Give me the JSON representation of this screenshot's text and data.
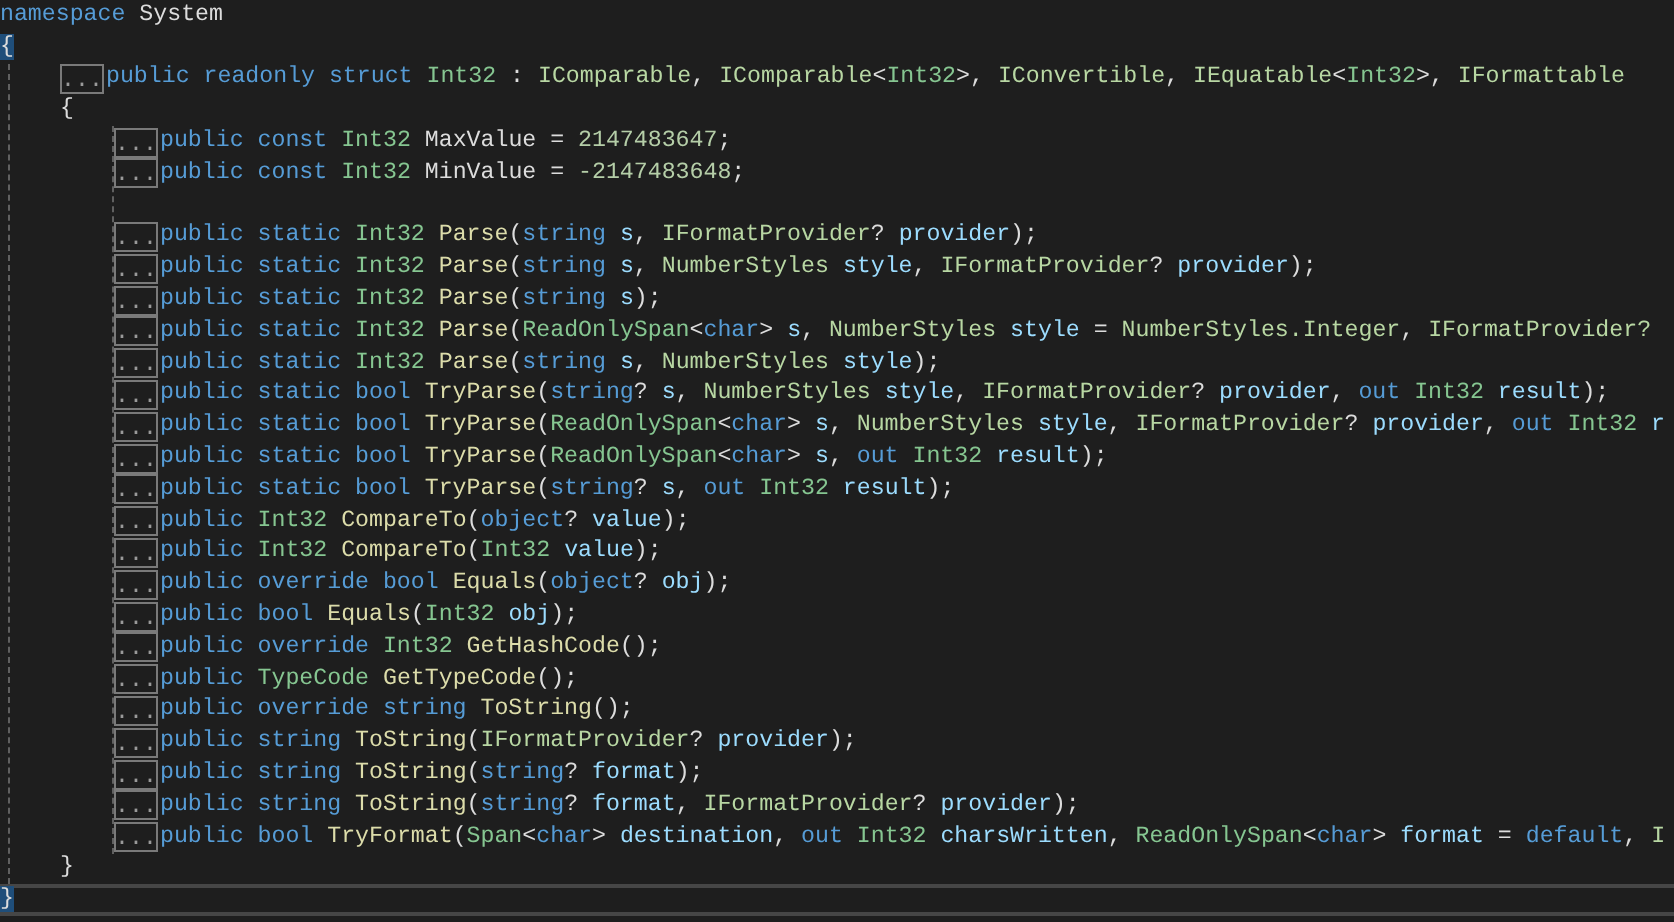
{
  "editor": {
    "lines": [
      {
        "kind": "code",
        "current": false,
        "tokens": [
          {
            "text": "namespace",
            "kind": "keyword"
          },
          {
            "text": " System",
            "kind": "plain"
          }
        ]
      },
      {
        "kind": "code",
        "current": false,
        "tokens": [
          {
            "text": "{",
            "kind": "brace",
            "matched": true
          }
        ],
        "children": [
          {
            "kind": "code",
            "current": false,
            "fold": "...",
            "tokens": [
              {
                "text": "public readonly struct ",
                "kind": "keyword"
              },
              {
                "text": "Int32",
                "kind": "type"
              },
              {
                "text": " : ",
                "kind": "plain"
              },
              {
                "text": "IComparable",
                "kind": "interface"
              },
              {
                "text": ", ",
                "kind": "plain"
              },
              {
                "text": "IComparable",
                "kind": "interface"
              },
              {
                "text": "<",
                "kind": "plain"
              },
              {
                "text": "Int32",
                "kind": "type"
              },
              {
                "text": ">, ",
                "kind": "plain"
              },
              {
                "text": "IConvertible",
                "kind": "interface"
              },
              {
                "text": ", ",
                "kind": "plain"
              },
              {
                "text": "IEquatable",
                "kind": "interface"
              },
              {
                "text": "<",
                "kind": "plain"
              },
              {
                "text": "Int32",
                "kind": "type"
              },
              {
                "text": ">, ",
                "kind": "plain"
              },
              {
                "text": "IFormattable",
                "kind": "interface"
              }
            ]
          },
          {
            "kind": "code",
            "current": false,
            "tokens": [
              {
                "text": "{",
                "kind": "brace",
                "matched": false
              }
            ],
            "children": [
              {
                "kind": "code",
                "current": false,
                "fold": "...",
                "tokens": [
                  {
                    "text": "public const ",
                    "kind": "keyword"
                  },
                  {
                    "text": "Int32",
                    "kind": "type"
                  },
                  {
                    "text": " MaxValue = ",
                    "kind": "plain"
                  },
                  {
                    "text": "2147483647",
                    "kind": "number"
                  },
                  {
                    "text": ";",
                    "kind": "plain"
                  }
                ]
              },
              {
                "kind": "code",
                "current": false,
                "fold": "...",
                "tokens": [
                  {
                    "text": "public const ",
                    "kind": "keyword"
                  },
                  {
                    "text": "Int32",
                    "kind": "type"
                  },
                  {
                    "text": " MinValue = ",
                    "kind": "plain"
                  },
                  {
                    "text": "-2147483648",
                    "kind": "number"
                  },
                  {
                    "text": ";",
                    "kind": "plain"
                  }
                ]
              },
              {
                "kind": "blank",
                "current": false
              },
              {
                "kind": "code",
                "current": false,
                "fold": "...",
                "tokens": [
                  {
                    "text": "public static ",
                    "kind": "keyword"
                  },
                  {
                    "text": "Int32 ",
                    "kind": "type"
                  },
                  {
                    "text": "Parse",
                    "kind": "method"
                  },
                  {
                    "text": "(",
                    "kind": "plain"
                  },
                  {
                    "text": "string ",
                    "kind": "keyword"
                  },
                  {
                    "text": "s",
                    "kind": "param"
                  },
                  {
                    "text": ", ",
                    "kind": "plain"
                  },
                  {
                    "text": "IFormatProvider",
                    "kind": "interface"
                  },
                  {
                    "text": "? ",
                    "kind": "plain"
                  },
                  {
                    "text": "provider",
                    "kind": "param"
                  },
                  {
                    "text": ");",
                    "kind": "plain"
                  }
                ]
              },
              {
                "kind": "code",
                "current": false,
                "fold": "...",
                "tokens": [
                  {
                    "text": "public static ",
                    "kind": "keyword"
                  },
                  {
                    "text": "Int32 ",
                    "kind": "type"
                  },
                  {
                    "text": "Parse",
                    "kind": "method"
                  },
                  {
                    "text": "(",
                    "kind": "plain"
                  },
                  {
                    "text": "string ",
                    "kind": "keyword"
                  },
                  {
                    "text": "s",
                    "kind": "param"
                  },
                  {
                    "text": ", ",
                    "kind": "plain"
                  },
                  {
                    "text": "NumberStyles ",
                    "kind": "interface"
                  },
                  {
                    "text": "style",
                    "kind": "param"
                  },
                  {
                    "text": ", ",
                    "kind": "plain"
                  },
                  {
                    "text": "IFormatProvider",
                    "kind": "interface"
                  },
                  {
                    "text": "? ",
                    "kind": "plain"
                  },
                  {
                    "text": "provider",
                    "kind": "param"
                  },
                  {
                    "text": ");",
                    "kind": "plain"
                  }
                ]
              },
              {
                "kind": "code",
                "current": false,
                "fold": "...",
                "tokens": [
                  {
                    "text": "public static ",
                    "kind": "keyword"
                  },
                  {
                    "text": "Int32 ",
                    "kind": "type"
                  },
                  {
                    "text": "Parse",
                    "kind": "method"
                  },
                  {
                    "text": "(",
                    "kind": "plain"
                  },
                  {
                    "text": "string ",
                    "kind": "keyword"
                  },
                  {
                    "text": "s",
                    "kind": "param"
                  },
                  {
                    "text": ");",
                    "kind": "plain"
                  }
                ]
              },
              {
                "kind": "code",
                "current": false,
                "fold": "...",
                "tokens": [
                  {
                    "text": "public static ",
                    "kind": "keyword"
                  },
                  {
                    "text": "Int32 ",
                    "kind": "type"
                  },
                  {
                    "text": "Parse",
                    "kind": "method"
                  },
                  {
                    "text": "(",
                    "kind": "plain"
                  },
                  {
                    "text": "ReadOnlySpan",
                    "kind": "type"
                  },
                  {
                    "text": "<",
                    "kind": "plain"
                  },
                  {
                    "text": "char",
                    "kind": "keyword"
                  },
                  {
                    "text": "> ",
                    "kind": "plain"
                  },
                  {
                    "text": "s",
                    "kind": "param"
                  },
                  {
                    "text": ", ",
                    "kind": "plain"
                  },
                  {
                    "text": "NumberStyles ",
                    "kind": "interface"
                  },
                  {
                    "text": "style",
                    "kind": "param"
                  },
                  {
                    "text": " = ",
                    "kind": "plain"
                  },
                  {
                    "text": "NumberStyles.Integer",
                    "kind": "interface"
                  },
                  {
                    "text": ", ",
                    "kind": "plain"
                  },
                  {
                    "text": "IFormatProvider?",
                    "kind": "interface"
                  }
                ]
              },
              {
                "kind": "code",
                "current": false,
                "fold": "...",
                "tokens": [
                  {
                    "text": "public static ",
                    "kind": "keyword"
                  },
                  {
                    "text": "Int32 ",
                    "kind": "type"
                  },
                  {
                    "text": "Parse",
                    "kind": "method"
                  },
                  {
                    "text": "(",
                    "kind": "plain"
                  },
                  {
                    "text": "string ",
                    "kind": "keyword"
                  },
                  {
                    "text": "s",
                    "kind": "param"
                  },
                  {
                    "text": ", ",
                    "kind": "plain"
                  },
                  {
                    "text": "NumberStyles ",
                    "kind": "interface"
                  },
                  {
                    "text": "style",
                    "kind": "param"
                  },
                  {
                    "text": ");",
                    "kind": "plain"
                  }
                ]
              },
              {
                "kind": "code",
                "current": false,
                "fold": "...",
                "tokens": [
                  {
                    "text": "public static bool ",
                    "kind": "keyword"
                  },
                  {
                    "text": "TryParse",
                    "kind": "method"
                  },
                  {
                    "text": "(",
                    "kind": "plain"
                  },
                  {
                    "text": "string",
                    "kind": "keyword"
                  },
                  {
                    "text": "? ",
                    "kind": "plain"
                  },
                  {
                    "text": "s",
                    "kind": "param"
                  },
                  {
                    "text": ", ",
                    "kind": "plain"
                  },
                  {
                    "text": "NumberStyles ",
                    "kind": "interface"
                  },
                  {
                    "text": "style",
                    "kind": "param"
                  },
                  {
                    "text": ", ",
                    "kind": "plain"
                  },
                  {
                    "text": "IFormatProvider",
                    "kind": "interface"
                  },
                  {
                    "text": "? ",
                    "kind": "plain"
                  },
                  {
                    "text": "provider",
                    "kind": "param"
                  },
                  {
                    "text": ", ",
                    "kind": "plain"
                  },
                  {
                    "text": "out ",
                    "kind": "keyword"
                  },
                  {
                    "text": "Int32 ",
                    "kind": "type"
                  },
                  {
                    "text": "result",
                    "kind": "param"
                  },
                  {
                    "text": ");",
                    "kind": "plain"
                  }
                ]
              },
              {
                "kind": "code",
                "current": false,
                "fold": "...",
                "tokens": [
                  {
                    "text": "public static bool ",
                    "kind": "keyword"
                  },
                  {
                    "text": "TryParse",
                    "kind": "method"
                  },
                  {
                    "text": "(",
                    "kind": "plain"
                  },
                  {
                    "text": "ReadOnlySpan",
                    "kind": "type"
                  },
                  {
                    "text": "<",
                    "kind": "plain"
                  },
                  {
                    "text": "char",
                    "kind": "keyword"
                  },
                  {
                    "text": "> ",
                    "kind": "plain"
                  },
                  {
                    "text": "s",
                    "kind": "param"
                  },
                  {
                    "text": ", ",
                    "kind": "plain"
                  },
                  {
                    "text": "NumberStyles ",
                    "kind": "interface"
                  },
                  {
                    "text": "style",
                    "kind": "param"
                  },
                  {
                    "text": ", ",
                    "kind": "plain"
                  },
                  {
                    "text": "IFormatProvider",
                    "kind": "interface"
                  },
                  {
                    "text": "? ",
                    "kind": "plain"
                  },
                  {
                    "text": "provider",
                    "kind": "param"
                  },
                  {
                    "text": ", ",
                    "kind": "plain"
                  },
                  {
                    "text": "out ",
                    "kind": "keyword"
                  },
                  {
                    "text": "Int32 ",
                    "kind": "type"
                  },
                  {
                    "text": "r",
                    "kind": "param"
                  }
                ]
              },
              {
                "kind": "code",
                "current": false,
                "fold": "...",
                "tokens": [
                  {
                    "text": "public static bool ",
                    "kind": "keyword"
                  },
                  {
                    "text": "TryParse",
                    "kind": "method"
                  },
                  {
                    "text": "(",
                    "kind": "plain"
                  },
                  {
                    "text": "ReadOnlySpan",
                    "kind": "type"
                  },
                  {
                    "text": "<",
                    "kind": "plain"
                  },
                  {
                    "text": "char",
                    "kind": "keyword"
                  },
                  {
                    "text": "> ",
                    "kind": "plain"
                  },
                  {
                    "text": "s",
                    "kind": "param"
                  },
                  {
                    "text": ", ",
                    "kind": "plain"
                  },
                  {
                    "text": "out ",
                    "kind": "keyword"
                  },
                  {
                    "text": "Int32 ",
                    "kind": "type"
                  },
                  {
                    "text": "result",
                    "kind": "param"
                  },
                  {
                    "text": ");",
                    "kind": "plain"
                  }
                ]
              },
              {
                "kind": "code",
                "current": false,
                "fold": "...",
                "tokens": [
                  {
                    "text": "public static bool ",
                    "kind": "keyword"
                  },
                  {
                    "text": "TryParse",
                    "kind": "method"
                  },
                  {
                    "text": "(",
                    "kind": "plain"
                  },
                  {
                    "text": "string",
                    "kind": "keyword"
                  },
                  {
                    "text": "? ",
                    "kind": "plain"
                  },
                  {
                    "text": "s",
                    "kind": "param"
                  },
                  {
                    "text": ", ",
                    "kind": "plain"
                  },
                  {
                    "text": "out ",
                    "kind": "keyword"
                  },
                  {
                    "text": "Int32 ",
                    "kind": "type"
                  },
                  {
                    "text": "result",
                    "kind": "param"
                  },
                  {
                    "text": ");",
                    "kind": "plain"
                  }
                ]
              },
              {
                "kind": "code",
                "current": false,
                "fold": "...",
                "tokens": [
                  {
                    "text": "public ",
                    "kind": "keyword"
                  },
                  {
                    "text": "Int32 ",
                    "kind": "type"
                  },
                  {
                    "text": "CompareTo",
                    "kind": "method"
                  },
                  {
                    "text": "(",
                    "kind": "plain"
                  },
                  {
                    "text": "object",
                    "kind": "keyword"
                  },
                  {
                    "text": "? ",
                    "kind": "plain"
                  },
                  {
                    "text": "value",
                    "kind": "param"
                  },
                  {
                    "text": ");",
                    "kind": "plain"
                  }
                ]
              },
              {
                "kind": "code",
                "current": false,
                "fold": "...",
                "tokens": [
                  {
                    "text": "public ",
                    "kind": "keyword"
                  },
                  {
                    "text": "Int32 ",
                    "kind": "type"
                  },
                  {
                    "text": "CompareTo",
                    "kind": "method"
                  },
                  {
                    "text": "(",
                    "kind": "plain"
                  },
                  {
                    "text": "Int32 ",
                    "kind": "type"
                  },
                  {
                    "text": "value",
                    "kind": "param"
                  },
                  {
                    "text": ");",
                    "kind": "plain"
                  }
                ]
              },
              {
                "kind": "code",
                "current": false,
                "fold": "...",
                "tokens": [
                  {
                    "text": "public override bool ",
                    "kind": "keyword"
                  },
                  {
                    "text": "Equals",
                    "kind": "method"
                  },
                  {
                    "text": "(",
                    "kind": "plain"
                  },
                  {
                    "text": "object",
                    "kind": "keyword"
                  },
                  {
                    "text": "? ",
                    "kind": "plain"
                  },
                  {
                    "text": "obj",
                    "kind": "param"
                  },
                  {
                    "text": ");",
                    "kind": "plain"
                  }
                ]
              },
              {
                "kind": "code",
                "current": false,
                "fold": "...",
                "tokens": [
                  {
                    "text": "public bool ",
                    "kind": "keyword"
                  },
                  {
                    "text": "Equals",
                    "kind": "method"
                  },
                  {
                    "text": "(",
                    "kind": "plain"
                  },
                  {
                    "text": "Int32 ",
                    "kind": "type"
                  },
                  {
                    "text": "obj",
                    "kind": "param"
                  },
                  {
                    "text": ");",
                    "kind": "plain"
                  }
                ]
              },
              {
                "kind": "code",
                "current": false,
                "fold": "...",
                "tokens": [
                  {
                    "text": "public override ",
                    "kind": "keyword"
                  },
                  {
                    "text": "Int32 ",
                    "kind": "type"
                  },
                  {
                    "text": "GetHashCode",
                    "kind": "method"
                  },
                  {
                    "text": "();",
                    "kind": "plain"
                  }
                ]
              },
              {
                "kind": "code",
                "current": false,
                "fold": "...",
                "tokens": [
                  {
                    "text": "public ",
                    "kind": "keyword"
                  },
                  {
                    "text": "TypeCode ",
                    "kind": "type"
                  },
                  {
                    "text": "GetTypeCode",
                    "kind": "method"
                  },
                  {
                    "text": "();",
                    "kind": "plain"
                  }
                ]
              },
              {
                "kind": "code",
                "current": false,
                "fold": "...",
                "tokens": [
                  {
                    "text": "public override string ",
                    "kind": "keyword"
                  },
                  {
                    "text": "ToString",
                    "kind": "method"
                  },
                  {
                    "text": "();",
                    "kind": "plain"
                  }
                ]
              },
              {
                "kind": "code",
                "current": false,
                "fold": "...",
                "tokens": [
                  {
                    "text": "public string ",
                    "kind": "keyword"
                  },
                  {
                    "text": "ToString",
                    "kind": "method"
                  },
                  {
                    "text": "(",
                    "kind": "plain"
                  },
                  {
                    "text": "IFormatProvider",
                    "kind": "interface"
                  },
                  {
                    "text": "? ",
                    "kind": "plain"
                  },
                  {
                    "text": "provider",
                    "kind": "param"
                  },
                  {
                    "text": ");",
                    "kind": "plain"
                  }
                ]
              },
              {
                "kind": "code",
                "current": false,
                "fold": "...",
                "tokens": [
                  {
                    "text": "public string ",
                    "kind": "keyword"
                  },
                  {
                    "text": "ToString",
                    "kind": "method"
                  },
                  {
                    "text": "(",
                    "kind": "plain"
                  },
                  {
                    "text": "string",
                    "kind": "keyword"
                  },
                  {
                    "text": "? ",
                    "kind": "plain"
                  },
                  {
                    "text": "format",
                    "kind": "param"
                  },
                  {
                    "text": ");",
                    "kind": "plain"
                  }
                ]
              },
              {
                "kind": "code",
                "current": false,
                "fold": "...",
                "tokens": [
                  {
                    "text": "public string ",
                    "kind": "keyword"
                  },
                  {
                    "text": "ToString",
                    "kind": "method"
                  },
                  {
                    "text": "(",
                    "kind": "plain"
                  },
                  {
                    "text": "string",
                    "kind": "keyword"
                  },
                  {
                    "text": "? ",
                    "kind": "plain"
                  },
                  {
                    "text": "format",
                    "kind": "param"
                  },
                  {
                    "text": ", ",
                    "kind": "plain"
                  },
                  {
                    "text": "IFormatProvider",
                    "kind": "interface"
                  },
                  {
                    "text": "? ",
                    "kind": "plain"
                  },
                  {
                    "text": "provider",
                    "kind": "param"
                  },
                  {
                    "text": ");",
                    "kind": "plain"
                  }
                ]
              },
              {
                "kind": "code",
                "current": false,
                "fold": "...",
                "tokens": [
                  {
                    "text": "public bool ",
                    "kind": "keyword"
                  },
                  {
                    "text": "TryFormat",
                    "kind": "method"
                  },
                  {
                    "text": "(",
                    "kind": "plain"
                  },
                  {
                    "text": "Span",
                    "kind": "type"
                  },
                  {
                    "text": "<",
                    "kind": "plain"
                  },
                  {
                    "text": "char",
                    "kind": "keyword"
                  },
                  {
                    "text": "> ",
                    "kind": "plain"
                  },
                  {
                    "text": "destination",
                    "kind": "param"
                  },
                  {
                    "text": ", ",
                    "kind": "plain"
                  },
                  {
                    "text": "out ",
                    "kind": "keyword"
                  },
                  {
                    "text": "Int32 ",
                    "kind": "type"
                  },
                  {
                    "text": "charsWritten",
                    "kind": "param"
                  },
                  {
                    "text": ", ",
                    "kind": "plain"
                  },
                  {
                    "text": "ReadOnlySpan",
                    "kind": "type"
                  },
                  {
                    "text": "<",
                    "kind": "plain"
                  },
                  {
                    "text": "char",
                    "kind": "keyword"
                  },
                  {
                    "text": "> ",
                    "kind": "plain"
                  },
                  {
                    "text": "format",
                    "kind": "param"
                  },
                  {
                    "text": " = ",
                    "kind": "plain"
                  },
                  {
                    "text": "default",
                    "kind": "keyword"
                  },
                  {
                    "text": ", ",
                    "kind": "plain"
                  },
                  {
                    "text": "I",
                    "kind": "interface"
                  }
                ]
              }
            ]
          },
          {
            "kind": "code",
            "current": false,
            "tokens": [
              {
                "text": "}",
                "kind": "brace",
                "matched": false
              }
            ]
          }
        ]
      },
      {
        "kind": "code",
        "current": true,
        "tokens": [
          {
            "text": "}",
            "kind": "brace",
            "matched": true
          }
        ]
      }
    ]
  }
}
